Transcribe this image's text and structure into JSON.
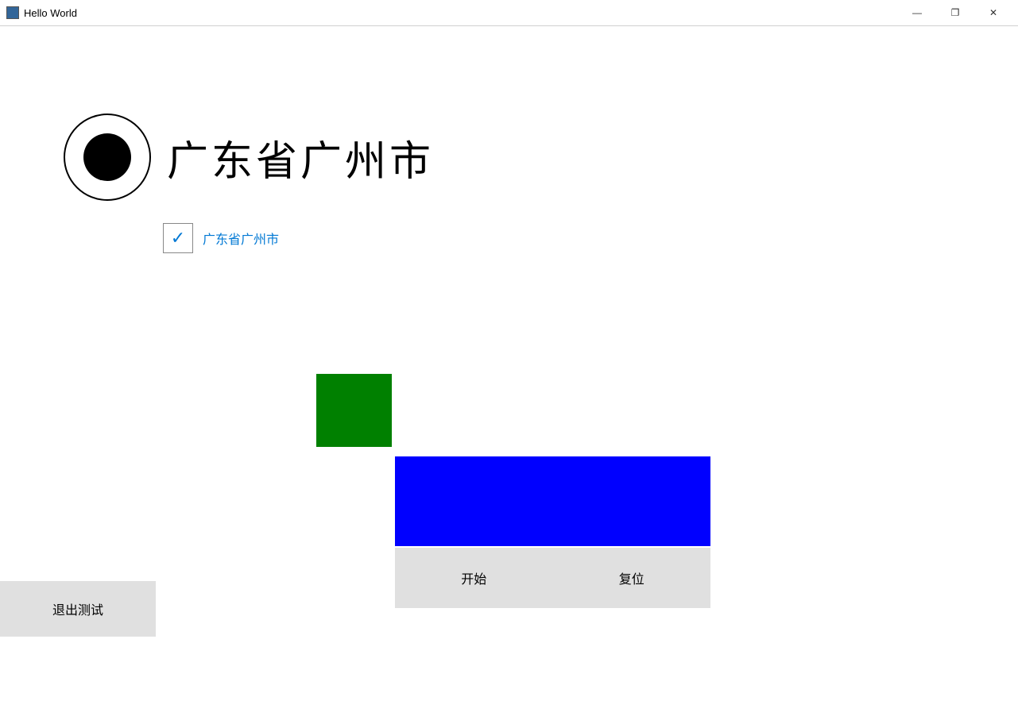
{
  "titleBar": {
    "title": "Hello World",
    "appIconLabel": "app-icon",
    "controls": {
      "minimize": "—",
      "maximize": "❐",
      "close": "✕"
    }
  },
  "locationLarge": "广东省广州市",
  "locationSmall": "广东省广州市",
  "colors": {
    "green": "#008000",
    "blue": "#0000ff",
    "blueSmall": "#0000ff"
  },
  "buttons": {
    "start": "开始",
    "reset": "复位",
    "exit": "退出测试"
  }
}
